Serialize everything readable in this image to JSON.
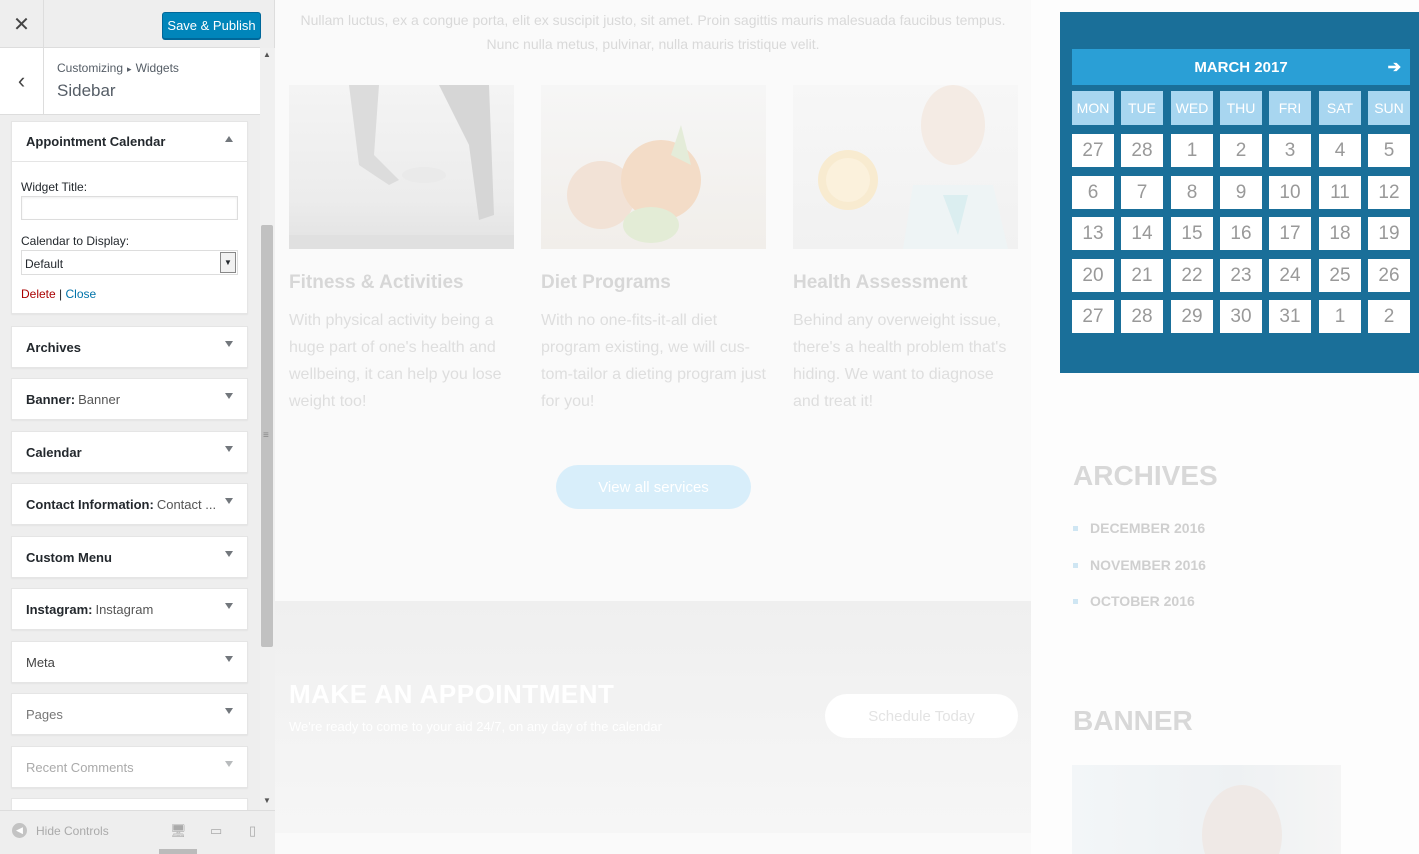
{
  "customizer": {
    "close_icon": "close-icon",
    "publish_label": "Save & Publish",
    "breadcrumb": {
      "root": "Customizing",
      "current": "Widgets"
    },
    "section_title": "Sidebar",
    "widgets": [
      {
        "name": "Appointment Calendar",
        "subtitle": "",
        "open": true
      },
      {
        "name": "Archives",
        "subtitle": ""
      },
      {
        "name": "Banner:",
        "subtitle": "Banner"
      },
      {
        "name": "Calendar",
        "subtitle": ""
      },
      {
        "name": "Contact Information:",
        "subtitle": "Contact ..."
      },
      {
        "name": "Custom Menu",
        "subtitle": ""
      },
      {
        "name": "Instagram:",
        "subtitle": "Instagram"
      },
      {
        "name": "Meta",
        "subtitle": ""
      },
      {
        "name": "Pages",
        "subtitle": ""
      },
      {
        "name": "Recent Comments",
        "subtitle": ""
      }
    ],
    "open_widget": {
      "title_label": "Widget Title:",
      "title_value": "",
      "calendar_label": "Calendar to Display:",
      "calendar_value": "Default",
      "delete_label": "Delete",
      "separator": "|",
      "close_label": "Close"
    },
    "footer": {
      "hide_controls_label": "Hide Controls"
    }
  },
  "preview": {
    "intro_text": "Nullam luctus, ex a congue porta, elit ex suscipit justo, sit amet. Proin sagittis mauris malesuada faucibus tempus. Nunc nulla metus, pulvinar, nulla mauris tristique velit.",
    "services": [
      {
        "title": "Fitness & Activities",
        "text": "With physical activity being a huge part of one's health and wellbeing, it can help you lose weight too!"
      },
      {
        "title": "Diet Programs",
        "text": "With no one-fits-it-all diet program existing, we will cus-tom-tailor a dieting program just for you!"
      },
      {
        "title": "Health Assessment",
        "text": "Behind any overweight issue, there's a health problem that's hiding. We want to diagnose and treat it!"
      }
    ],
    "view_all_label": "View all services",
    "appointment": {
      "heading": "MAKE AN APPOINTMENT",
      "text": "We're ready to come to your aid 24/7, on any day of the calendar",
      "button": "Schedule Today"
    },
    "calendar": {
      "month": "MARCH 2017",
      "days": [
        "MON",
        "TUE",
        "WED",
        "THU",
        "FRI",
        "SAT",
        "SUN"
      ],
      "weeks": [
        [
          "27",
          "28",
          "1",
          "2",
          "3",
          "4",
          "5"
        ],
        [
          "6",
          "7",
          "8",
          "9",
          "10",
          "11",
          "12"
        ],
        [
          "13",
          "14",
          "15",
          "16",
          "17",
          "18",
          "19"
        ],
        [
          "20",
          "21",
          "22",
          "23",
          "24",
          "25",
          "26"
        ],
        [
          "27",
          "28",
          "29",
          "30",
          "31",
          "1",
          "2"
        ]
      ]
    },
    "archives": {
      "heading": "ARCHIVES",
      "items": [
        "DECEMBER 2016",
        "NOVEMBER 2016",
        "OCTOBER 2016"
      ]
    },
    "banner_heading": "BANNER"
  },
  "colors": {
    "publish": "#0085ba",
    "calendar_bg": "#1a6f99",
    "calendar_header": "#2a9fd6",
    "calendar_dayname": "#a8d6f0",
    "delete_link": "#aa0000",
    "close_link": "#0073aa"
  }
}
